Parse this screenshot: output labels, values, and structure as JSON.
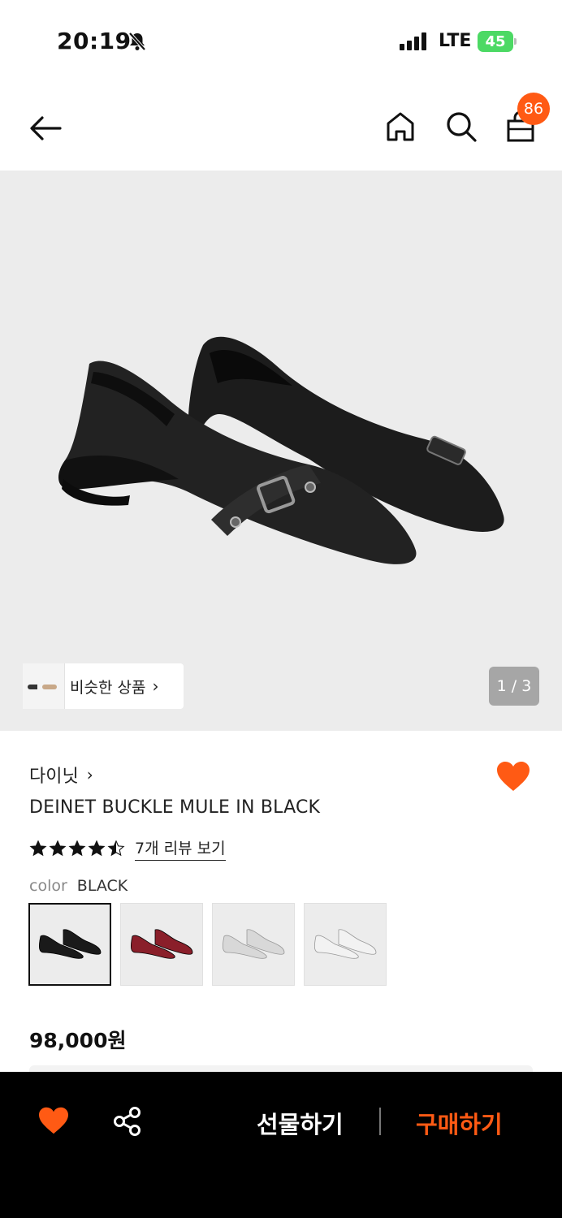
{
  "status_bar": {
    "time": "20:19",
    "network": "LTE",
    "battery": "45"
  },
  "header": {
    "cart_count": "86"
  },
  "hero": {
    "similar_label": "비슷한 상품",
    "pager": "1 / 3"
  },
  "product": {
    "brand": "다이닛",
    "name": "DEINET BUCKLE MULE IN BLACK",
    "rating": 4.5,
    "review_link": "7개 리뷰 보기",
    "color_key": "color",
    "color_value": "BLACK",
    "price": "98,000원",
    "swatches": [
      {
        "color": "#1a1a1a",
        "selected": true
      },
      {
        "color": "#8a1f2a",
        "selected": false
      },
      {
        "color": "#d8d8d8",
        "selected": false
      },
      {
        "color": "#f2f2f2",
        "selected": false
      }
    ]
  },
  "bottom_bar": {
    "gift_label": "선물하기",
    "buy_label": "구매하기"
  },
  "colors": {
    "accent": "#ff5a14",
    "battery": "#4cd964"
  },
  "icons": [
    "back-arrow-icon",
    "home-icon",
    "search-icon",
    "shopping-bag-icon",
    "heart-icon",
    "share-icon",
    "star-icon",
    "silent-bell-icon"
  ]
}
